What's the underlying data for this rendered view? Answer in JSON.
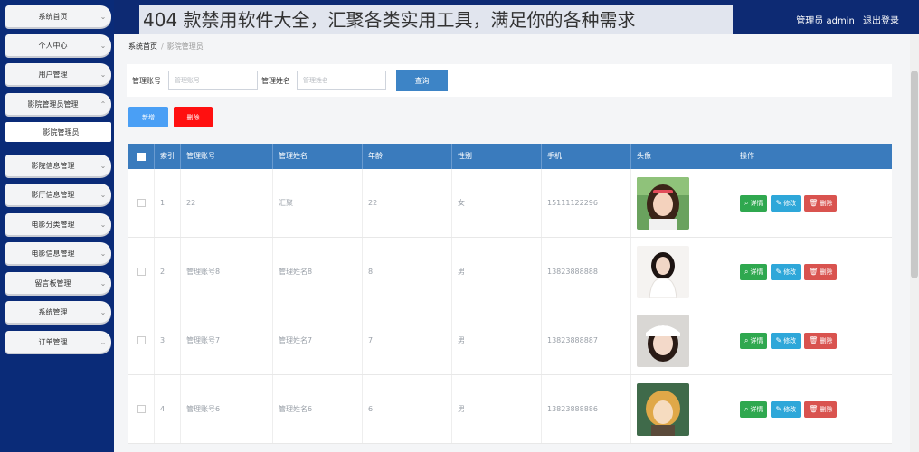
{
  "banner": "404 款禁用软件大全，汇聚各类实用工具，满足你的各种需求",
  "header": {
    "user": "管理员 admin",
    "logout": "退出登录"
  },
  "sidebar": {
    "items": [
      {
        "label": "系统首页"
      },
      {
        "label": "个人中心"
      },
      {
        "label": "用户管理"
      },
      {
        "label": "影院管理员管理"
      },
      {
        "label": "影院管理员"
      },
      {
        "label": "影院信息管理"
      },
      {
        "label": "影厅信息管理"
      },
      {
        "label": "电影分类管理"
      },
      {
        "label": "电影信息管理"
      },
      {
        "label": "留言板管理"
      },
      {
        "label": "系统管理"
      },
      {
        "label": "订单管理"
      }
    ]
  },
  "breadcrumb": {
    "home": "系统首页",
    "current": "影院管理员"
  },
  "search": {
    "account_label": "管理账号",
    "account_placeholder": "管理账号",
    "name_label": "管理姓名",
    "name_placeholder": "管理姓名",
    "query": "查询"
  },
  "actions": {
    "add": "新增",
    "delete": "删除"
  },
  "table": {
    "headers": [
      "索引",
      "管理账号",
      "管理姓名",
      "年龄",
      "性别",
      "手机",
      "头像",
      "操作"
    ],
    "rows": [
      {
        "index": "1",
        "account": "22",
        "name": "汇聚",
        "age": "22",
        "gender": "女",
        "phone": "15111122296"
      },
      {
        "index": "2",
        "account": "管理账号8",
        "name": "管理姓名8",
        "age": "8",
        "gender": "男",
        "phone": "13823888888"
      },
      {
        "index": "3",
        "account": "管理账号7",
        "name": "管理姓名7",
        "age": "7",
        "gender": "男",
        "phone": "13823888887"
      },
      {
        "index": "4",
        "account": "管理账号6",
        "name": "管理姓名6",
        "age": "6",
        "gender": "男",
        "phone": "13823888886"
      }
    ],
    "ops": {
      "detail": "详情",
      "edit": "修改",
      "remove": "删除"
    }
  },
  "colors": {
    "header_bg": "#0d2a73",
    "query_btn": "#3d84c6",
    "add_btn": "#4a9ff5",
    "delete_btn": "#ff1010",
    "table_head": "#3a7bbd"
  }
}
